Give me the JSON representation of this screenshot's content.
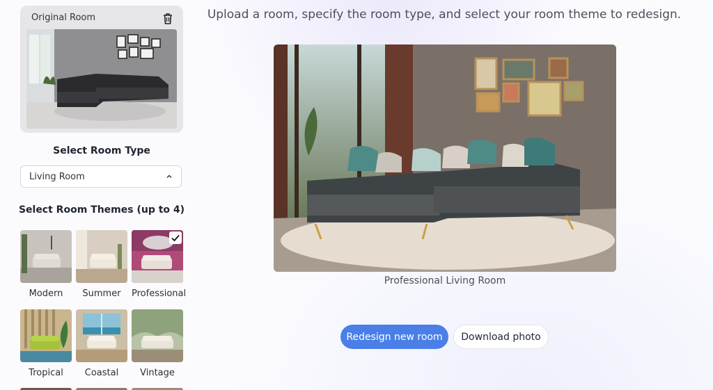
{
  "sidebar": {
    "original_card": {
      "title": "Original Room",
      "delete_icon": "trash-icon"
    },
    "room_type": {
      "heading": "Select Room Type",
      "selected": "Living Room",
      "chevron_icon": "chevron-up-icon"
    },
    "themes": {
      "heading": "Select Room Themes (up to 4)",
      "items": [
        {
          "label": "Modern",
          "selected": false
        },
        {
          "label": "Summer",
          "selected": false
        },
        {
          "label": "Professional",
          "selected": true
        },
        {
          "label": "Tropical",
          "selected": false
        },
        {
          "label": "Coastal",
          "selected": false
        },
        {
          "label": "Vintage",
          "selected": false
        }
      ]
    }
  },
  "main": {
    "subtitle": "Upload a room, specify the room type, and select your room theme to redesign.",
    "result_caption": "Professional Living Room",
    "buttons": {
      "redesign": "Redesign new room",
      "download": "Download photo"
    }
  },
  "colors": {
    "accent": "#4a7fe8",
    "card_bg": "#e6e6e9"
  }
}
